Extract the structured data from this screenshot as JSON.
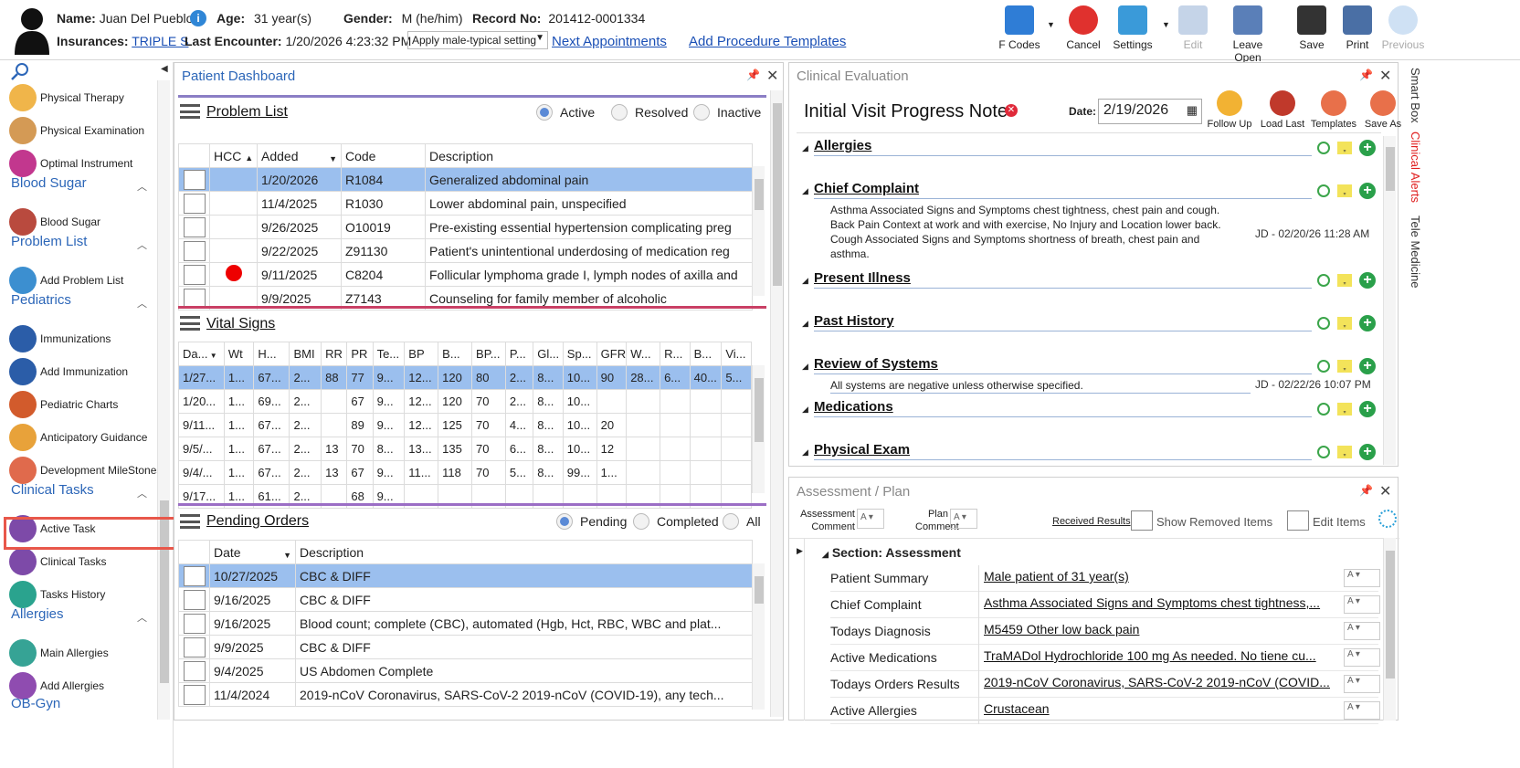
{
  "patient": {
    "name_label": "Name:",
    "name": "Juan Del Pueblo",
    "age_label": "Age:",
    "age": "31 year(s)",
    "gender_label": "Gender:",
    "gender": "M (he/him)",
    "record_label": "Record No:",
    "record": "201412-0001334",
    "insurances_label": "Insurances:",
    "insurance": "TRIPLE S",
    "last_encounter_label": "Last Encounter:",
    "last_encounter": "1/20/2026 4:23:32 PM",
    "setting_select": "Apply male-typical setting",
    "next_appointments": "Next Appointments",
    "add_procedure_templates": "Add Procedure Templates"
  },
  "toolbar": [
    {
      "label": "F Codes",
      "icon": "fcodes-icon",
      "color": "#2f7dd6"
    },
    {
      "label": "Cancel",
      "icon": "cancel-icon",
      "color": "#e0312e"
    },
    {
      "label": "Settings",
      "icon": "settings-icon",
      "color": "#3a9ad9"
    },
    {
      "label": "Edit",
      "icon": "edit-icon",
      "color": "#c5d4e8"
    },
    {
      "label": "Leave Open",
      "icon": "leave-open-icon",
      "color": "#5a7fb8"
    },
    {
      "label": "Save",
      "icon": "save-icon",
      "color": "#333"
    },
    {
      "label": "Print",
      "icon": "print-icon",
      "color": "#4a6fa5"
    },
    {
      "label": "Previous",
      "icon": "previous-icon",
      "color": "#cfe1f4"
    }
  ],
  "sidebar": {
    "items_top": [
      {
        "label": "Physical Therapy",
        "icon": "physical-therapy-icon",
        "color": "#f0b54a"
      },
      {
        "label": "Physical Examination",
        "icon": "physical-examination-icon",
        "color": "#d49a55"
      },
      {
        "label": "Optimal Instrument",
        "icon": "optimal-instrument-icon",
        "color": "#c2378e"
      }
    ],
    "groups": [
      {
        "title": "Blood Sugar",
        "items": [
          {
            "label": "Blood Sugar",
            "icon": "blood-sugar-icon",
            "color": "#b94a3e"
          }
        ]
      },
      {
        "title": "Problem List",
        "items": [
          {
            "label": "Add Problem List",
            "icon": "stethoscope-icon",
            "color": "#3c8fd0"
          }
        ]
      },
      {
        "title": "Pediatrics",
        "items": [
          {
            "label": "Immunizations",
            "icon": "syringe-icon",
            "color": "#2b5da8"
          },
          {
            "label": "Add Immunization",
            "icon": "add-syringe-icon",
            "color": "#2b5da8"
          },
          {
            "label": "Pediatric Charts",
            "icon": "chart-icon",
            "color": "#d25b2c"
          },
          {
            "label": "Anticipatory Guidance",
            "icon": "abacus-icon",
            "color": "#e8a23a"
          },
          {
            "label": "Development MileStones",
            "icon": "milestones-icon",
            "color": "#e06a4c"
          }
        ]
      },
      {
        "title": "Clinical Tasks",
        "items": [
          {
            "label": "Active Task",
            "icon": "active-task-icon",
            "color": "#7d4aa8"
          },
          {
            "label": "Clinical Tasks",
            "icon": "clinical-tasks-icon",
            "color": "#7d4aa8"
          },
          {
            "label": "Tasks History",
            "icon": "tasks-history-icon",
            "color": "#2aa38e"
          }
        ]
      },
      {
        "title": "Allergies",
        "items": [
          {
            "label": "Main Allergies",
            "icon": "main-allergies-icon",
            "color": "#36a395"
          },
          {
            "label": "Add Allergies",
            "icon": "add-allergies-icon",
            "color": "#8f4cb0"
          }
        ]
      }
    ],
    "cut_off_group": "OB-Gyn"
  },
  "dashboard": {
    "title": "Patient Dashboard",
    "problem_list": {
      "title": "Problem List",
      "filters": [
        "Active",
        "Resolved",
        "Inactive"
      ],
      "columns": [
        "HCC",
        "Added",
        "Code",
        "Description"
      ],
      "rows": [
        {
          "added": "1/20/2026",
          "code": "R1084",
          "desc": "Generalized abdominal pain",
          "hcc": false
        },
        {
          "added": "11/4/2025",
          "code": "R1030",
          "desc": "Lower abdominal pain, unspecified",
          "hcc": false
        },
        {
          "added": "9/26/2025",
          "code": "O10019",
          "desc": "Pre-existing essential hypertension complicating preg",
          "hcc": false
        },
        {
          "added": "9/22/2025",
          "code": "Z91130",
          "desc": "Patient's unintentional underdosing of medication reg",
          "hcc": false
        },
        {
          "added": "9/11/2025",
          "code": "C8204",
          "desc": "Follicular lymphoma grade I, lymph nodes of axilla and",
          "hcc": true
        },
        {
          "added": "9/9/2025",
          "code": "Z7143",
          "desc": "Counseling for family member of alcoholic",
          "hcc": false
        }
      ]
    },
    "vital_signs": {
      "title": "Vital Signs",
      "columns": [
        "Da...",
        "Wt",
        "H...",
        "BMI",
        "RR",
        "PR",
        "Te...",
        "BP",
        "B...",
        "BP...",
        "P...",
        "Gl...",
        "Sp...",
        "GFR",
        "W...",
        "R...",
        "B...",
        "Vi..."
      ],
      "rows": [
        [
          "1/27...",
          "1...",
          "67...",
          "2...",
          "88",
          "77",
          "9...",
          "12...",
          "120",
          "80",
          "2...",
          "8...",
          "10...",
          "90",
          "28...",
          "6...",
          "40...",
          "5..."
        ],
        [
          "1/20...",
          "1...",
          "69...",
          "2...",
          "",
          "67",
          "9...",
          "12...",
          "120",
          "70",
          "2...",
          "8...",
          "10...",
          "",
          "",
          "",
          "",
          ""
        ],
        [
          "9/11...",
          "1...",
          "67...",
          "2...",
          "",
          "89",
          "9...",
          "12...",
          "125",
          "70",
          "4...",
          "8...",
          "10...",
          "20",
          "",
          "",
          "",
          ""
        ],
        [
          "9/5/...",
          "1...",
          "67...",
          "2...",
          "13",
          "70",
          "8...",
          "13...",
          "135",
          "70",
          "6...",
          "8...",
          "10...",
          "12",
          "",
          "",
          "",
          ""
        ],
        [
          "9/4/...",
          "1...",
          "67...",
          "2...",
          "13",
          "67",
          "9...",
          "11...",
          "118",
          "70",
          "5...",
          "8...",
          "99...",
          "1...",
          "",
          "",
          "",
          ""
        ],
        [
          "9/17...",
          "1...",
          "61...",
          "2...",
          "",
          "68",
          "9...",
          "",
          "",
          "",
          "",
          "",
          "",
          "",
          "",
          "",
          "",
          ""
        ]
      ]
    },
    "pending_orders": {
      "title": "Pending Orders",
      "filters": [
        "Pending",
        "Completed",
        "All"
      ],
      "columns": [
        "Date",
        "Description"
      ],
      "rows": [
        {
          "date": "10/27/2025",
          "desc": "CBC & DIFF"
        },
        {
          "date": "9/16/2025",
          "desc": "CBC & DIFF"
        },
        {
          "date": "9/16/2025",
          "desc": "Blood count; complete (CBC), automated (Hgb, Hct, RBC, WBC and plat..."
        },
        {
          "date": "9/9/2025",
          "desc": "CBC & DIFF"
        },
        {
          "date": "9/4/2025",
          "desc": "US Abdomen Complete"
        },
        {
          "date": "11/4/2024",
          "desc": "2019-nCoV Coronavirus, SARS-CoV-2 2019-nCoV (COVID-19), any tech..."
        }
      ]
    }
  },
  "clinical_eval": {
    "title": "Clinical Evaluation",
    "note_title": "Initial Visit Progress Note",
    "date_label": "Date:",
    "date": "2/19/2026",
    "actions": [
      {
        "label": "Follow Up",
        "icon": "follow-up-icon",
        "color": "#f2b233"
      },
      {
        "label": "Load Last",
        "icon": "load-last-icon",
        "color": "#c0392b"
      },
      {
        "label": "Templates",
        "icon": "templates-icon",
        "color": "#e8704a"
      },
      {
        "label": "Save As",
        "icon": "save-as-icon",
        "color": "#e8704a"
      }
    ],
    "sections": [
      {
        "name": "Allergies",
        "text": "",
        "stamp": ""
      },
      {
        "name": "Chief Complaint",
        "text": "Asthma Associated Signs and Symptoms chest tightness, chest pain and cough. Back Pain Context at work and with exercise, No Injury and Location lower back. Cough Associated Signs and Symptoms shortness of breath, chest pain and asthma.",
        "stamp": "JD - 02/20/26 11:28 AM"
      },
      {
        "name": "Present Illness",
        "text": "",
        "stamp": ""
      },
      {
        "name": "Past History",
        "text": "",
        "stamp": ""
      },
      {
        "name": "Review of Systems",
        "text": "All systems are negative unless otherwise specified.",
        "stamp": "JD - 02/22/26 10:07 PM"
      },
      {
        "name": "Medications",
        "text": "",
        "stamp": ""
      },
      {
        "name": "Physical Exam",
        "text": "",
        "stamp": ""
      }
    ]
  },
  "assessment": {
    "title": "Assessment / Plan",
    "assessment_comment": "Assessment Comment",
    "plan_comment": "Plan Comment",
    "received_results": "Received Results",
    "show_removed": "Show Removed Items",
    "edit_items": "Edit Items",
    "section": "Section: Assessment",
    "rows": [
      {
        "label": "Patient Summary",
        "value": "Male patient of 31 year(s)"
      },
      {
        "label": "Chief Complaint",
        "value": " Asthma Associated Signs and Symptoms chest tightness,..."
      },
      {
        "label": "Todays Diagnosis",
        "value": " M5459 Other low back pain"
      },
      {
        "label": "Active Medications",
        "value": "TraMADol Hydrochloride 100 mg As needed.  No tiene cu..."
      },
      {
        "label": "Todays Orders Results",
        "value": "2019-nCoV Coronavirus, SARS-CoV-2 2019-nCoV (COVID..."
      },
      {
        "label": "Active Allergies",
        "value": "Crustacean"
      }
    ]
  },
  "right_tabs": [
    "Smart Box",
    "Clinical Alerts",
    "Tele Medicine"
  ],
  "colors": {
    "accent": "#2c66b8",
    "selection": "#9bbfee",
    "highlight": "#e8574a",
    "alerts": "#e02020"
  }
}
